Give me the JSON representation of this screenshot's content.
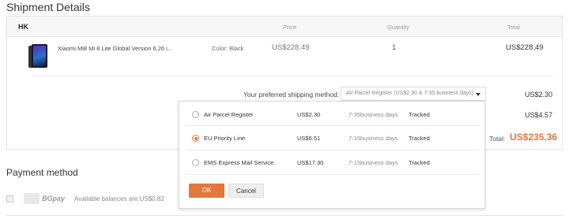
{
  "shipment": {
    "title": "Shipment Details",
    "country": "HK",
    "headers": {
      "price": "Price",
      "quantity": "Quantity",
      "total": "Total"
    },
    "product": {
      "name": "Xiaomi Mi8 Mi 8 Lite Global Version 6.26 i...",
      "color": "Color: Black",
      "price": "US$228.49",
      "quantity": "1",
      "total": "US$228.49"
    },
    "shipping_label": "Your preferred shipping method:",
    "shipping_selected": "Air Parcel Register (US$2.30 & 7-35 business days)",
    "shipping_cost": "US$2.30",
    "shipping_cost_2": "US$4.57",
    "total_label": "Total:",
    "total_value": "US$235.36"
  },
  "popup": {
    "options": [
      {
        "name": "Air Parcel Register",
        "price": "US$2.30",
        "days": "7-35business days",
        "tracking": "Tracked",
        "selected": false
      },
      {
        "name": "EU Priority Line",
        "price": "US$6.51",
        "days": "7-15business days",
        "tracking": "Tracked",
        "selected": true
      },
      {
        "name": "EMS Express Mail Service",
        "price": "US$17.30",
        "days": "7-15business days",
        "tracking": "Tracked",
        "selected": false
      }
    ],
    "ok_label": "OK",
    "cancel_label": "Cancel"
  },
  "payment": {
    "title": "Payment method",
    "method_name": "BGpay",
    "balance": "Available balances are:US$0.82"
  },
  "colors": {
    "accent": "#e4773a",
    "border": "#e3e3e3"
  }
}
